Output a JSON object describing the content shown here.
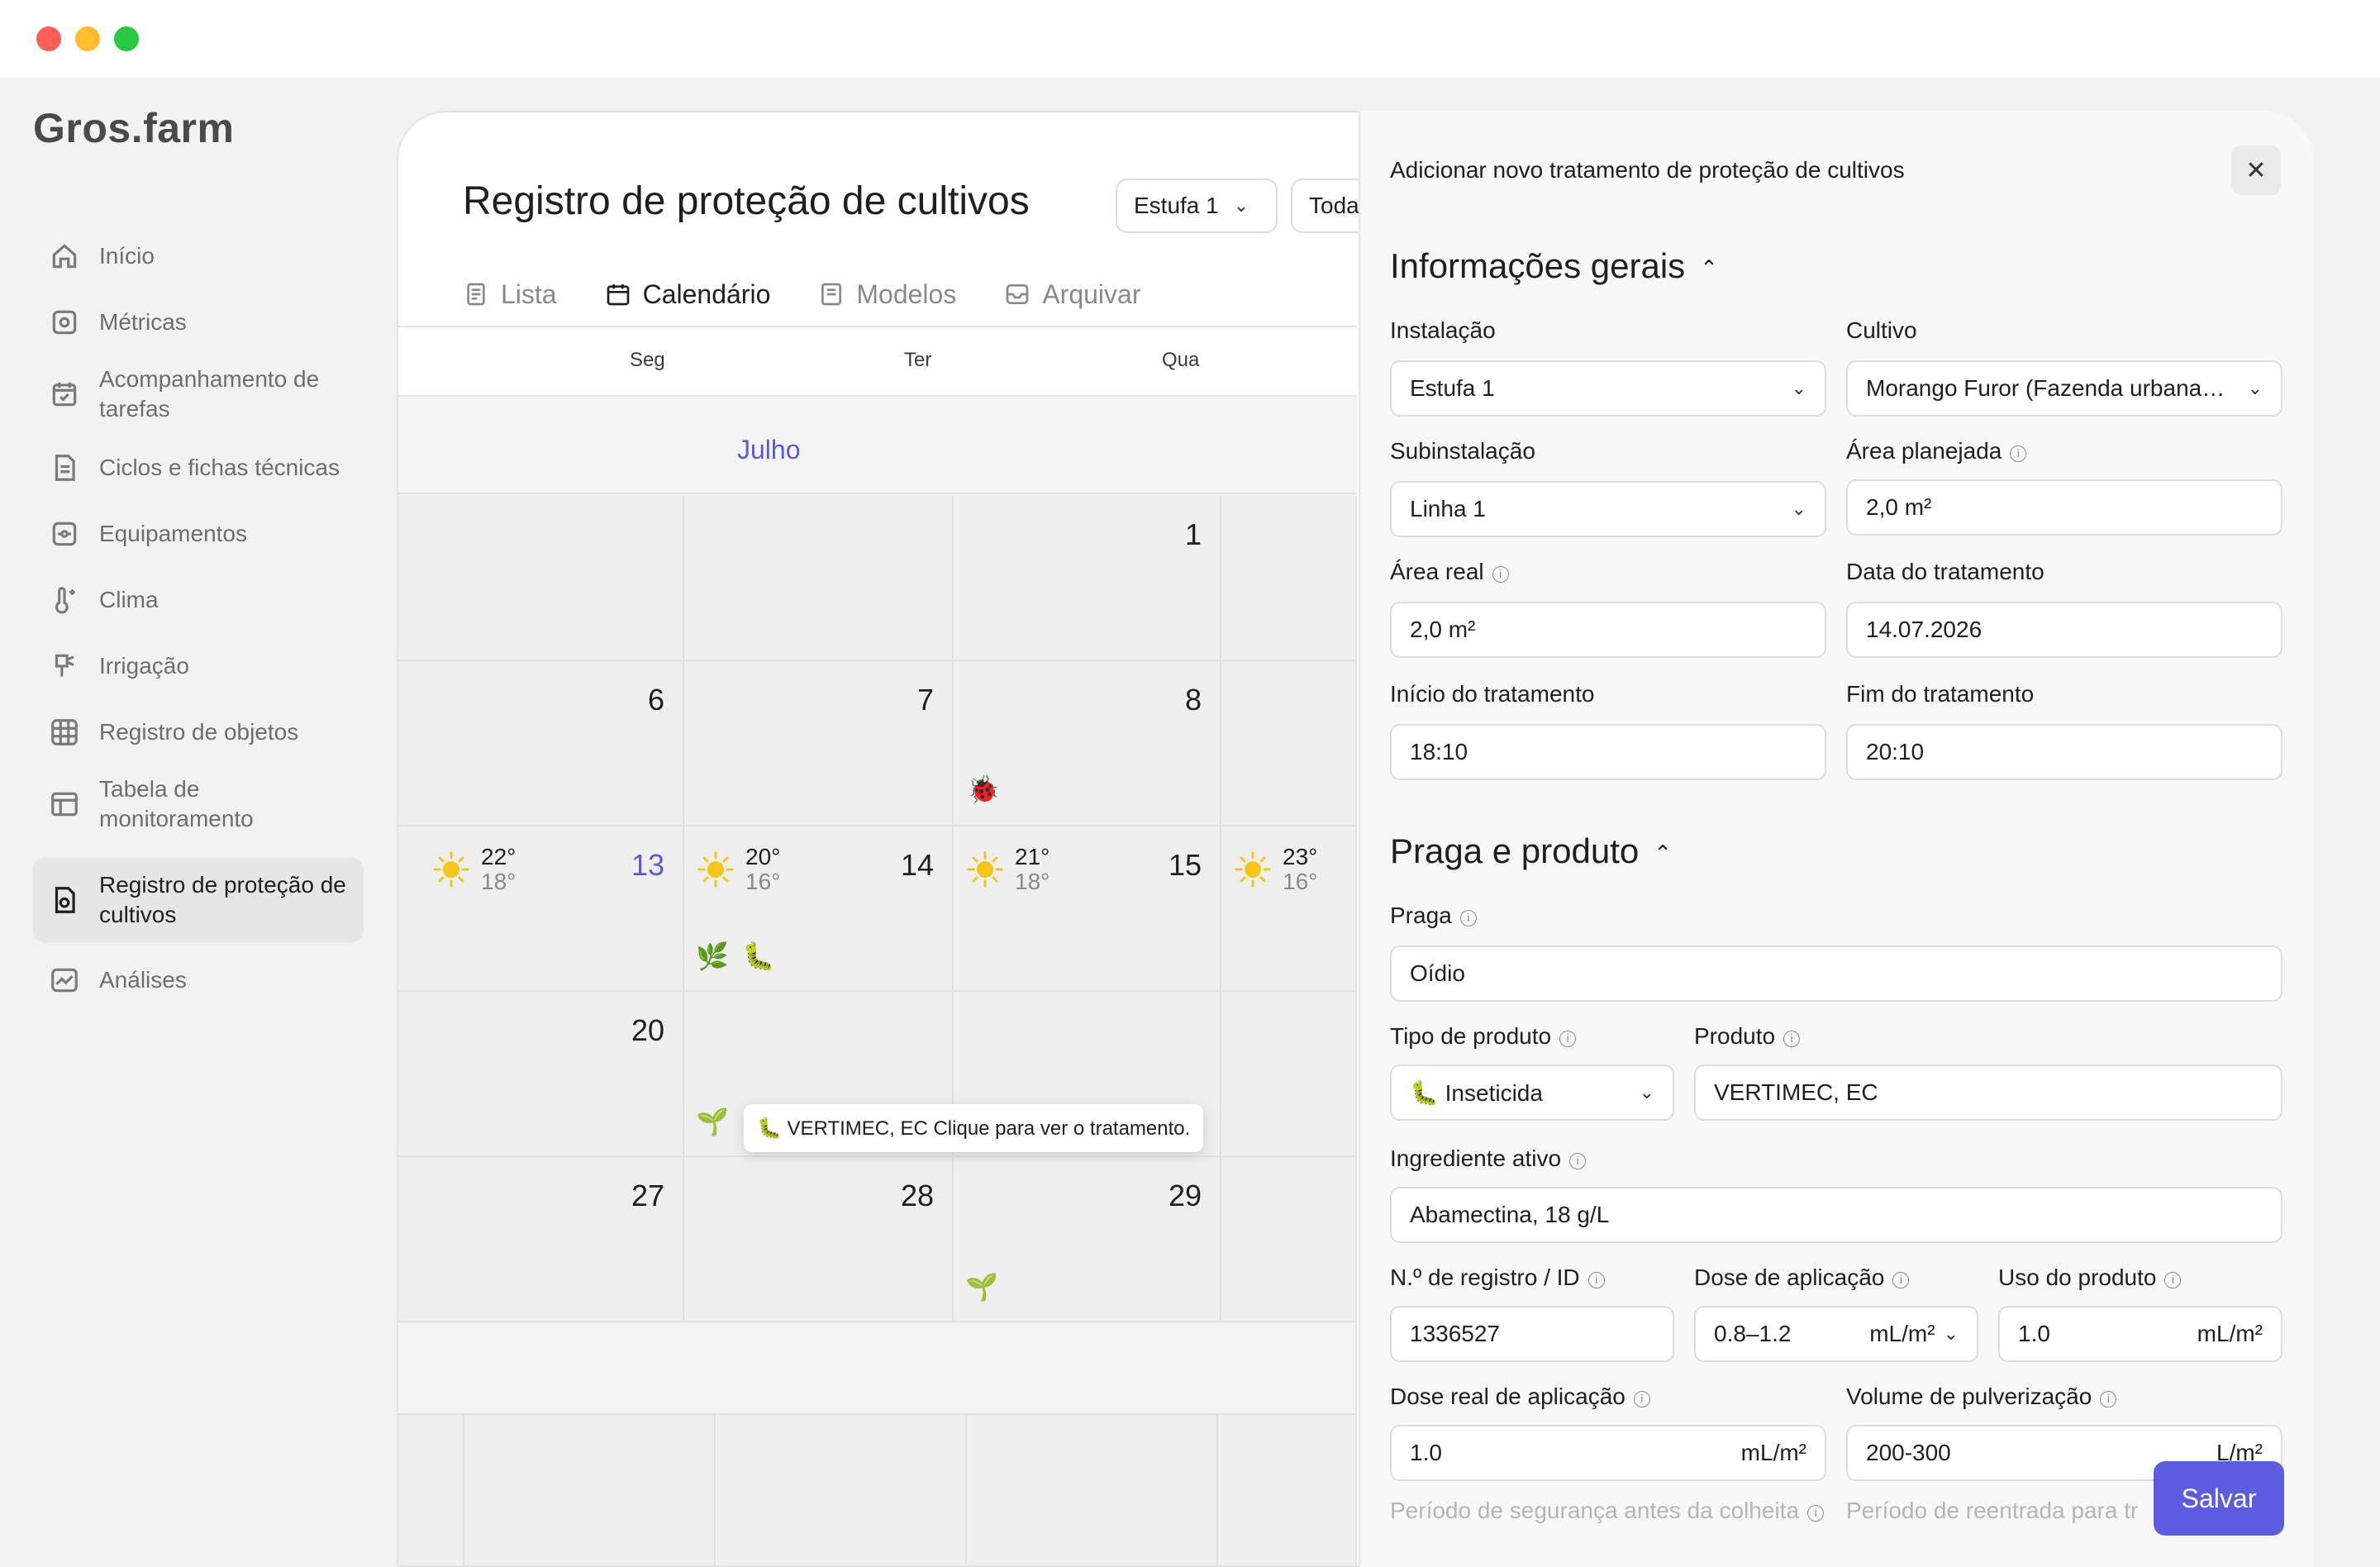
{
  "app": {
    "logo": "Gros.farm"
  },
  "sidebar": {
    "items": [
      {
        "label": "Início",
        "icon": "home-icon"
      },
      {
        "label": "Métricas",
        "icon": "metrics-icon"
      },
      {
        "label": "Acompanhamento de tarefas",
        "icon": "tasks-icon"
      },
      {
        "label": "Ciclos e fichas técnicas",
        "icon": "document-icon"
      },
      {
        "label": "Equipamentos",
        "icon": "equipment-icon"
      },
      {
        "label": "Clima",
        "icon": "climate-icon"
      },
      {
        "label": "Irrigação",
        "icon": "irrigation-icon"
      },
      {
        "label": "Registro de objetos",
        "icon": "grid-icon"
      },
      {
        "label": "Tabela de monitoramento",
        "icon": "table-icon"
      },
      {
        "label": "Registro de proteção de cultivos",
        "icon": "protection-icon",
        "active": true
      },
      {
        "label": "Análises",
        "icon": "analytics-icon"
      }
    ]
  },
  "header": {
    "title": "Registro de proteção de cultivos",
    "facility_select": "Estufa 1",
    "second_select": "Toda"
  },
  "tabs": [
    {
      "label": "Lista",
      "icon": "list-icon"
    },
    {
      "label": "Calendário",
      "icon": "calendar-icon",
      "active": true
    },
    {
      "label": "Modelos",
      "icon": "templates-icon"
    },
    {
      "label": "Arquivar",
      "icon": "archive-icon"
    }
  ],
  "calendar": {
    "weekdays": [
      "Seg",
      "Ter",
      "Qua"
    ],
    "month": "Julho",
    "days": {
      "d1": "1",
      "d6": "6",
      "d7": "7",
      "d8": "8",
      "d13": "13",
      "d14": "14",
      "d15": "15",
      "d20": "20",
      "d27": "27",
      "d28": "28",
      "d29": "29"
    },
    "weather": [
      {
        "hi": "22°",
        "lo": "18°"
      },
      {
        "hi": "20°",
        "lo": "16°"
      },
      {
        "hi": "21°",
        "lo": "18°"
      },
      {
        "hi": "23°",
        "lo": "16°"
      }
    ],
    "markers": {
      "ladybug": "🐞",
      "herb": "🌿",
      "caterpillar": "🐛",
      "seedling": "🌱"
    },
    "tooltip": "🐛 VERTIMEC, EC Clique para ver o tratamento."
  },
  "drawer": {
    "title": "Adicionar novo tratamento de proteção de cultivos",
    "general_section": "Informações gerais",
    "pest_section": "Praga e produto",
    "labels": {
      "instalacao": "Instalação",
      "cultivo": "Cultivo",
      "subinstalacao": "Subinstalação",
      "area_planejada": "Área planejada",
      "area_real": "Área real",
      "data_tratamento": "Data do tratamento",
      "inicio": "Início do tratamento",
      "fim": "Fim do tratamento",
      "praga": "Praga",
      "tipo_produto": "Tipo de produto",
      "produto": "Produto",
      "ingrediente": "Ingrediente ativo",
      "registro": "N.º de registro / ID",
      "dose": "Dose de aplicação",
      "uso": "Uso do produto",
      "dose_real": "Dose real de aplicação",
      "volume": "Volume de pulverização",
      "periodo_seguranca": "Período de segurança antes da colheita",
      "periodo_reentrada": "Período de reentrada para tr"
    },
    "values": {
      "instalacao": "Estufa 1",
      "cultivo": "Morango Furor (Fazenda urbana…",
      "subinstalacao": "Linha 1",
      "area_planejada": "2,0 m²",
      "area_real": "2,0 m²",
      "data_tratamento": "14.07.2026",
      "inicio": "18:10",
      "fim": "20:10",
      "praga": "Oídio",
      "tipo_produto": "🐛 Inseticida",
      "produto": "VERTIMEC, EC",
      "ingrediente": "Abamectina, 18 g/L",
      "registro": "1336527",
      "dose": "0.8–1.2",
      "dose_unit": "mL/m²",
      "uso": "1.0",
      "uso_unit": "mL/m²",
      "dose_real": "1.0",
      "dose_real_unit": "mL/m²",
      "volume": "200-300",
      "volume_unit": "L/m²"
    },
    "save": "Salvar"
  }
}
